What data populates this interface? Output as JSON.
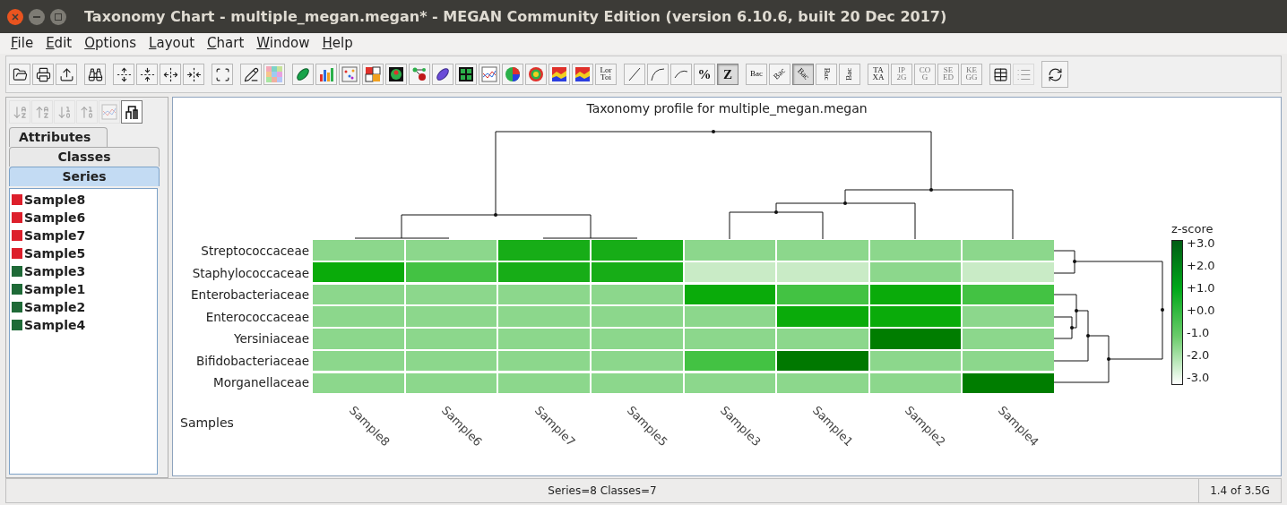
{
  "window": {
    "title": "Taxonomy Chart - multiple_megan.megan* - MEGAN Community Edition (version 6.10.6, built 20 Dec 2017)"
  },
  "menu": [
    "File",
    "Edit",
    "Options",
    "Layout",
    "Chart",
    "Window",
    "Help"
  ],
  "toolbar": [
    [
      {
        "kind": "open"
      },
      {
        "kind": "print"
      },
      {
        "kind": "export"
      }
    ],
    [
      {
        "kind": "find"
      }
    ],
    [
      {
        "kind": "expand-vertical"
      },
      {
        "kind": "contract-vertical"
      },
      {
        "kind": "expand-horizontal"
      },
      {
        "kind": "contract-horizontal"
      }
    ],
    [
      {
        "kind": "fit"
      }
    ],
    [
      {
        "kind": "edit"
      },
      {
        "kind": "color-grid"
      }
    ],
    [
      {
        "kind": "pill"
      },
      {
        "kind": "bars"
      },
      {
        "kind": "dots"
      },
      {
        "kind": "quadrants"
      },
      {
        "kind": "radar"
      },
      {
        "kind": "network"
      },
      {
        "kind": "pill-purple"
      },
      {
        "kind": "grid"
      },
      {
        "kind": "lines"
      },
      {
        "kind": "pie"
      },
      {
        "kind": "rings"
      },
      {
        "kind": "area"
      },
      {
        "kind": "area"
      },
      {
        "kind": "text",
        "label": "Lor Toi",
        "disabled": false,
        "selected": false
      }
    ],
    [
      {
        "kind": "straight"
      },
      {
        "kind": "curve"
      },
      {
        "kind": "arc"
      },
      {
        "kind": "text",
        "label": "%",
        "disabled": false,
        "selected": false
      },
      {
        "kind": "text",
        "label": "Z",
        "disabled": false,
        "selected": true
      }
    ],
    [
      {
        "kind": "text",
        "label": "Bac",
        "disabled": false,
        "selected": false
      },
      {
        "kind": "rising",
        "label": "Bac",
        "disabled": false,
        "selected": false
      },
      {
        "kind": "falling",
        "label": "Bac",
        "disabled": false,
        "selected": true
      },
      {
        "kind": "down",
        "label": "Bac",
        "disabled": false,
        "selected": false
      },
      {
        "kind": "up",
        "label": "Bac",
        "disabled": false,
        "selected": false
      }
    ],
    [
      {
        "kind": "text",
        "label": "TA XA",
        "disabled": false,
        "selected": false
      },
      {
        "kind": "text",
        "label": "IP 2G",
        "disabled": true,
        "selected": false
      },
      {
        "kind": "text",
        "label": "CO G",
        "disabled": true,
        "selected": false
      },
      {
        "kind": "text",
        "label": "SE ED",
        "disabled": true,
        "selected": false
      },
      {
        "kind": "text",
        "label": "KE GG",
        "disabled": true,
        "selected": false
      }
    ],
    [
      {
        "kind": "table"
      },
      {
        "kind": "list",
        "disabled": true
      }
    ],
    [
      {
        "kind": "sync"
      }
    ]
  ],
  "side_tools": [
    {
      "kind": "sort-down-alpha",
      "disabled": true,
      "selected": false
    },
    {
      "kind": "sort-up-alpha",
      "disabled": true,
      "selected": false
    },
    {
      "kind": "sort-down-num",
      "disabled": true,
      "selected": false
    },
    {
      "kind": "sort-up-num",
      "disabled": true,
      "selected": false
    },
    {
      "kind": "lines",
      "disabled": true,
      "selected": false
    },
    {
      "kind": "tree",
      "disabled": false,
      "selected": true
    }
  ],
  "tabs": [
    {
      "label": "Attributes",
      "selected": false
    },
    {
      "label": "Classes",
      "selected": false
    },
    {
      "label": "Series",
      "selected": true
    }
  ],
  "series": [
    {
      "name": "Sample8",
      "color": "#dd1f2b"
    },
    {
      "name": "Sample6",
      "color": "#dd1f2b"
    },
    {
      "name": "Sample7",
      "color": "#dd1f2b"
    },
    {
      "name": "Sample5",
      "color": "#dd1f2b"
    },
    {
      "name": "Sample3",
      "color": "#1f6a37"
    },
    {
      "name": "Sample1",
      "color": "#1f6a37"
    },
    {
      "name": "Sample2",
      "color": "#1f6a37"
    },
    {
      "name": "Sample4",
      "color": "#1f6a37"
    }
  ],
  "chart": {
    "title": "Taxonomy profile for multiple_megan.megan",
    "axis_label": "Samples",
    "columns": [
      "Sample8",
      "Sample6",
      "Sample7",
      "Sample5",
      "Sample3",
      "Sample1",
      "Sample2",
      "Sample4"
    ],
    "rows": [
      {
        "name": "Streptococcaceae",
        "cells": [
          {
            "color": "#8cd78c"
          },
          {
            "color": "#8cd78c"
          },
          {
            "color": "#17ad17"
          },
          {
            "color": "#17ad17"
          },
          {
            "color": "#8cd78c"
          },
          {
            "color": "#8cd78c"
          },
          {
            "color": "#8cd78c"
          },
          {
            "color": "#8cd78c"
          }
        ]
      },
      {
        "name": "Staphylococcaceae",
        "cells": [
          {
            "color": "#0aab0a"
          },
          {
            "color": "#43c243"
          },
          {
            "color": "#17ad17"
          },
          {
            "color": "#17ad17"
          },
          {
            "color": "#c9ebc6"
          },
          {
            "color": "#c9ebc6"
          },
          {
            "color": "#8cd78c"
          },
          {
            "color": "#c9ebc6"
          }
        ]
      },
      {
        "name": "Enterobacteriaceae",
        "cells": [
          {
            "color": "#8cd78c"
          },
          {
            "color": "#8cd78c"
          },
          {
            "color": "#8cd78c"
          },
          {
            "color": "#8cd78c"
          },
          {
            "color": "#0aab0a"
          },
          {
            "color": "#43c243"
          },
          {
            "color": "#0aab0a"
          },
          {
            "color": "#43c243"
          }
        ]
      },
      {
        "name": "Enterococcaceae",
        "cells": [
          {
            "color": "#8cd78c"
          },
          {
            "color": "#8cd78c"
          },
          {
            "color": "#8cd78c"
          },
          {
            "color": "#8cd78c"
          },
          {
            "color": "#8cd78c"
          },
          {
            "color": "#0aab0a"
          },
          {
            "color": "#0aab0a"
          },
          {
            "color": "#8cd78c"
          }
        ]
      },
      {
        "name": "Yersiniaceae",
        "cells": [
          {
            "color": "#8cd78c"
          },
          {
            "color": "#8cd78c"
          },
          {
            "color": "#8cd78c"
          },
          {
            "color": "#8cd78c"
          },
          {
            "color": "#8cd78c"
          },
          {
            "color": "#8cd78c"
          },
          {
            "color": "#007d00"
          },
          {
            "color": "#8cd78c"
          }
        ]
      },
      {
        "name": "Bifidobacteriaceae",
        "cells": [
          {
            "color": "#8cd78c"
          },
          {
            "color": "#8cd78c"
          },
          {
            "color": "#8cd78c"
          },
          {
            "color": "#8cd78c"
          },
          {
            "color": "#43c243"
          },
          {
            "color": "#007800"
          },
          {
            "color": "#8cd78c"
          },
          {
            "color": "#8cd78c"
          }
        ]
      },
      {
        "name": "Morganellaceae",
        "cells": [
          {
            "color": "#8cd78c"
          },
          {
            "color": "#8cd78c"
          },
          {
            "color": "#8cd78c"
          },
          {
            "color": "#8cd78c"
          },
          {
            "color": "#8cd78c"
          },
          {
            "color": "#8cd78c"
          },
          {
            "color": "#8cd78c"
          },
          {
            "color": "#007d00"
          }
        ]
      }
    ],
    "legend": {
      "title": "z-score",
      "ticks": [
        "+3.0",
        "+2.0",
        "+1.0",
        "+0.0",
        "-1.0",
        "-2.0",
        "-3.0"
      ]
    }
  },
  "status_bar": {
    "summary": "Series=8 Classes=7",
    "memory": "1.4 of 3.5G"
  }
}
